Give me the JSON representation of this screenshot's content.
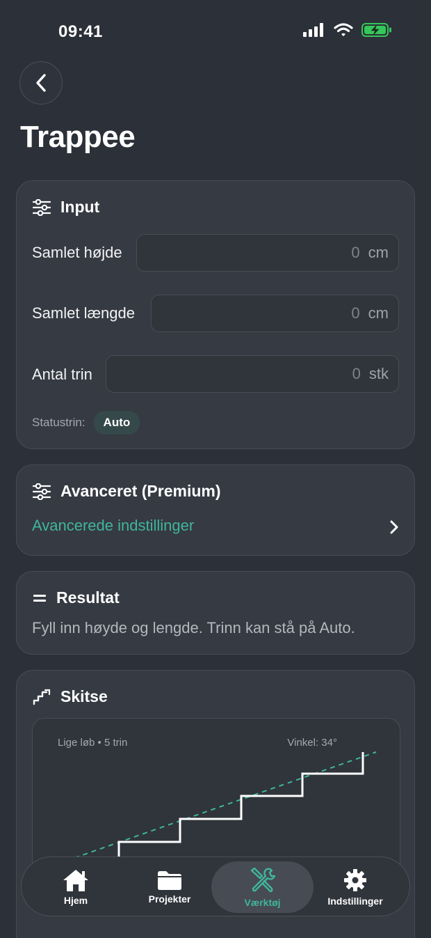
{
  "status_bar": {
    "time": "09:41",
    "icons": [
      "signal-icon",
      "wifi-icon",
      "battery-charging-icon"
    ]
  },
  "header": {
    "title": "Trappee",
    "back_icon": "chevron-left-icon"
  },
  "input_card": {
    "title": "Input",
    "icon": "sliders-icon",
    "fields": [
      {
        "label": "Samlet højde",
        "value": "0",
        "unit": "cm"
      },
      {
        "label": "Samlet længde",
        "value": "0",
        "unit": "cm"
      },
      {
        "label": "Antal trin",
        "value": "0",
        "unit": "stk"
      }
    ],
    "status_label": "Statustrin:",
    "status_value": "Auto"
  },
  "advanced_card": {
    "title": "Avanceret (Premium)",
    "icon": "sliders-icon",
    "link": "Avancerede indstillinger"
  },
  "result_card": {
    "title": "Resultat",
    "icon": "equals-icon",
    "text": "Fyll inn høyde og lengde. Trinn kan stå på Auto."
  },
  "sketch_card": {
    "title": "Skitse",
    "icon": "stairs-icon",
    "caption_left": "Lige løb • 5 trin",
    "caption_right": "Vinkel: 34°",
    "steps": 5
  },
  "tab_bar": {
    "tabs": [
      {
        "label": "Hjem",
        "icon": "home-icon",
        "active": false
      },
      {
        "label": "Projekter",
        "icon": "folder-icon",
        "active": false
      },
      {
        "label": "Værktøj",
        "icon": "tools-icon",
        "active": true
      },
      {
        "label": "Indstillinger",
        "icon": "gear-icon",
        "active": false
      }
    ]
  },
  "colors": {
    "background": "#2c3038",
    "card": "#363a42",
    "accent": "#3fb59d",
    "battery": "#34c759"
  }
}
